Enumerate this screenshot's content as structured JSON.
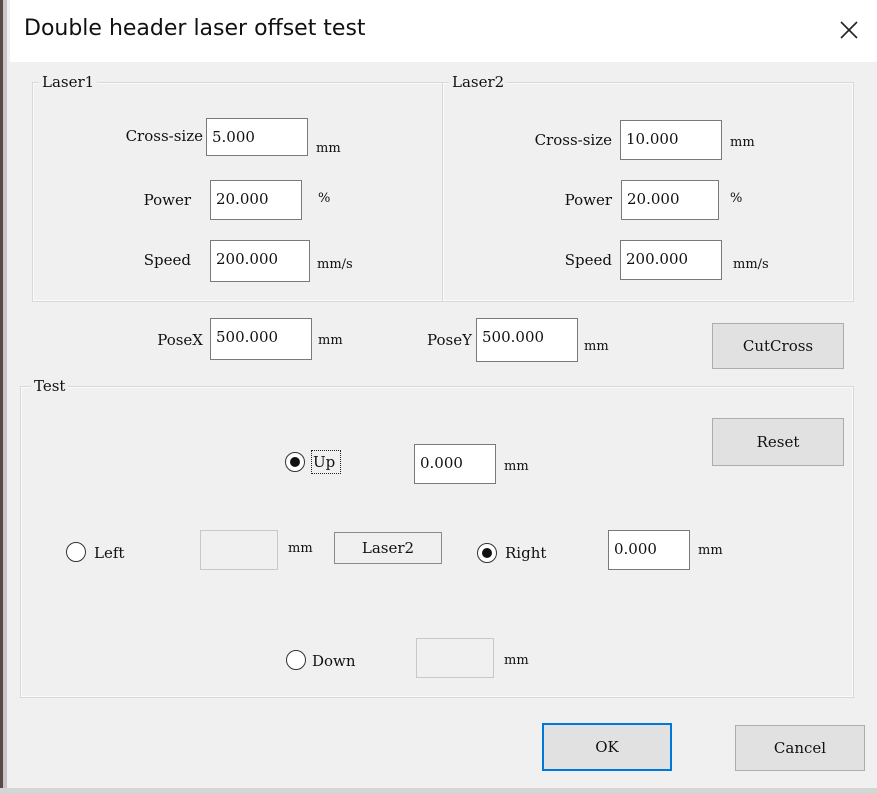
{
  "window": {
    "title": "Double header laser offset test",
    "close_icon": "close-icon"
  },
  "laser1": {
    "legend": "Laser1",
    "cross_size": {
      "label": "Cross-size",
      "value": "5.000",
      "unit": "mm"
    },
    "power": {
      "label": "Power",
      "value": "20.000",
      "unit": "%"
    },
    "speed": {
      "label": "Speed",
      "value": "200.000",
      "unit": "mm/s"
    }
  },
  "laser2": {
    "legend": "Laser2",
    "cross_size": {
      "label": "Cross-size",
      "value": "10.000",
      "unit": "mm"
    },
    "power": {
      "label": "Power",
      "value": "20.000",
      "unit": "%"
    },
    "speed": {
      "label": "Speed",
      "value": "200.000",
      "unit": "mm/s"
    }
  },
  "pose": {
    "x": {
      "label": "PoseX",
      "value": "500.000",
      "unit": "mm"
    },
    "y": {
      "label": "PoseY",
      "value": "500.000",
      "unit": "mm"
    },
    "cut_cross_label": "CutCross"
  },
  "test": {
    "legend": "Test",
    "reset_label": "Reset",
    "up": {
      "label": "Up",
      "value": "0.000",
      "unit": "mm",
      "selected": true
    },
    "left": {
      "label": "Left",
      "value": "",
      "unit": "mm",
      "selected": false
    },
    "laser_indicator": "Laser2",
    "right": {
      "label": "Right",
      "value": "0.000",
      "unit": "mm",
      "selected": true
    },
    "down": {
      "label": "Down",
      "value": "",
      "unit": "mm",
      "selected": false
    }
  },
  "footer": {
    "ok_label": "OK",
    "cancel_label": "Cancel"
  },
  "colors": {
    "dialog_bg": "#f0f0f0",
    "titlebar_bg": "#ffffff",
    "default_button_border": "#0078d7"
  }
}
